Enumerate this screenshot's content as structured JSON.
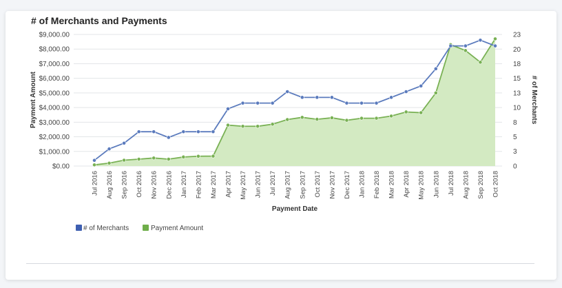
{
  "chart_data": {
    "type": "line",
    "title": "# of Merchants and Payments",
    "xlabel": "Payment Date",
    "ylabel_left": "Payment Amount",
    "ylabel_right": "# of Merchants",
    "categories": [
      "Jul 2016",
      "Aug 2016",
      "Sep 2016",
      "Oct 2016",
      "Nov 2016",
      "Dec 2016",
      "Jan 2017",
      "Feb 2017",
      "Mar 2017",
      "Apr 2017",
      "May 2017",
      "Jun 2017",
      "Jul 2017",
      "Aug 2017",
      "Sep 2017",
      "Oct 2017",
      "Nov 2017",
      "Dec 2017",
      "Jan 2018",
      "Feb 2018",
      "Mar 2018",
      "Apr 2018",
      "May 2018",
      "Jun 2018",
      "Jul 2018",
      "Aug 2018",
      "Sep 2018",
      "Oct 2018"
    ],
    "left_axis": {
      "ylim": [
        0,
        9000
      ],
      "ticks": [
        0,
        1000,
        2000,
        3000,
        4000,
        5000,
        6000,
        7000,
        8000,
        9000
      ],
      "tick_labels": [
        "$0.00",
        "$1,000.00",
        "$2,000.00",
        "$3,000.00",
        "$4,000.00",
        "$5,000.00",
        "$6,000.00",
        "$7,000.00",
        "$8,000.00",
        "$9,000.00"
      ]
    },
    "right_axis": {
      "ylim": [
        0,
        23
      ],
      "ticks": [
        0,
        2.56,
        5.11,
        7.67,
        10.22,
        12.78,
        15.33,
        17.89,
        20.44,
        23
      ],
      "tick_labels": [
        "0",
        "3",
        "5",
        "8",
        "10",
        "13",
        "15",
        "18",
        "20",
        "23"
      ]
    },
    "grid": true,
    "legend": "bottom-left",
    "series": [
      {
        "name": "# of Merchants",
        "axis": "right",
        "type": "line",
        "color": "#5b7bbd",
        "values": [
          1,
          3,
          4,
          6,
          6,
          5,
          6,
          6,
          6,
          10,
          11,
          11,
          11,
          13,
          12,
          12,
          12,
          11,
          11,
          11,
          12,
          13,
          14,
          17,
          21,
          21,
          22,
          21
        ]
      },
      {
        "name": "Payment Amount",
        "axis": "left",
        "type": "area",
        "color": "#79b154",
        "fill": "#d3eac2",
        "values": [
          80,
          200,
          400,
          470,
          550,
          470,
          620,
          670,
          680,
          2800,
          2720,
          2720,
          2860,
          3180,
          3330,
          3200,
          3300,
          3130,
          3270,
          3270,
          3420,
          3700,
          3650,
          5000,
          8300,
          7900,
          7100,
          8700
        ]
      }
    ]
  }
}
